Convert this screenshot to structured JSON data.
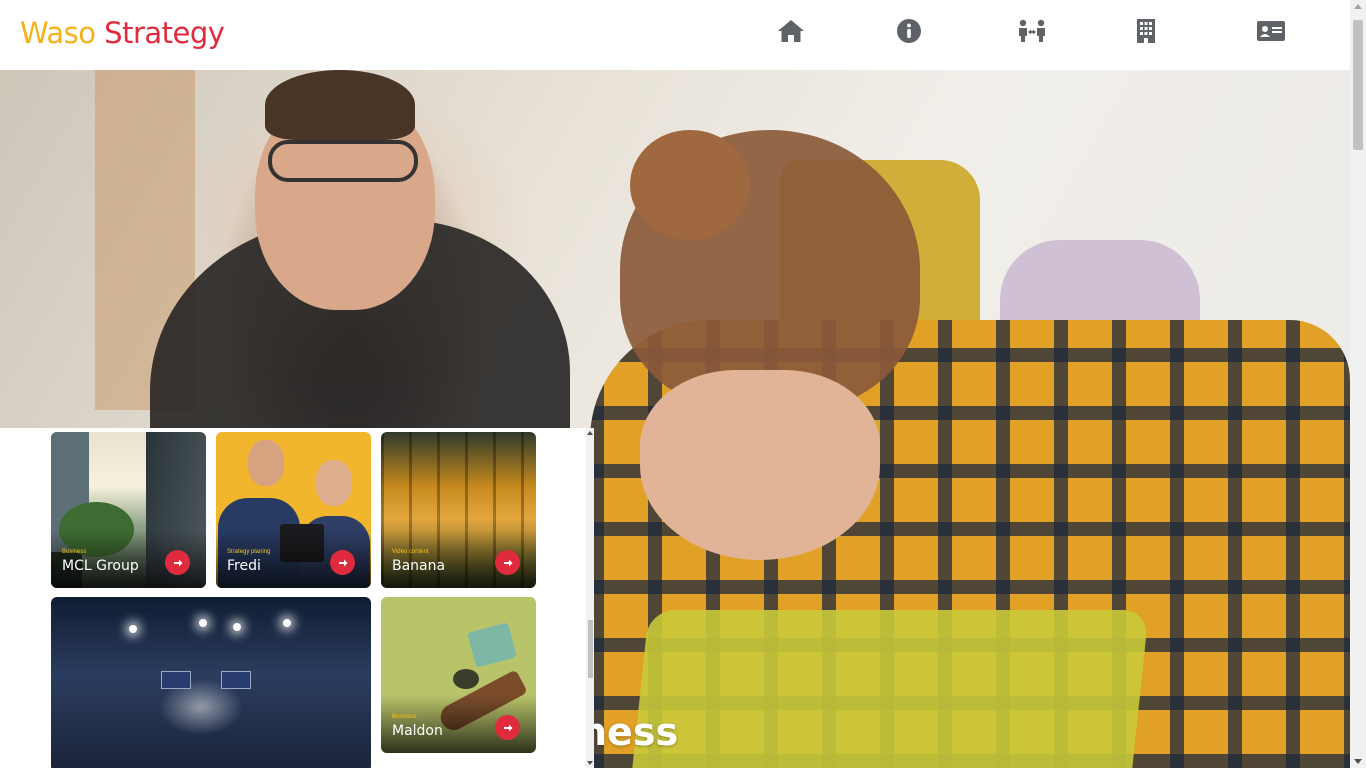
{
  "brand": {
    "word1": "Waso",
    "word2": "Strategy",
    "color1": "#f6b21b",
    "color2": "#e02b3f"
  },
  "nav": {
    "items": [
      {
        "icon": "home-icon"
      },
      {
        "icon": "info-icon"
      },
      {
        "icon": "team-icon"
      },
      {
        "icon": "building-icon"
      },
      {
        "icon": "contact-card-icon"
      }
    ],
    "icon_color": "#5f6368"
  },
  "hero": {
    "text": "ness"
  },
  "projects": [
    {
      "category": "Business",
      "name": "MCL Group"
    },
    {
      "category": "Strategy planing",
      "name": "Fredi"
    },
    {
      "category": "Video content",
      "name": "Banana"
    },
    {
      "category": "",
      "name": ""
    },
    {
      "category": "Business",
      "name": "Maldon"
    }
  ],
  "accent": "#e02b3f"
}
